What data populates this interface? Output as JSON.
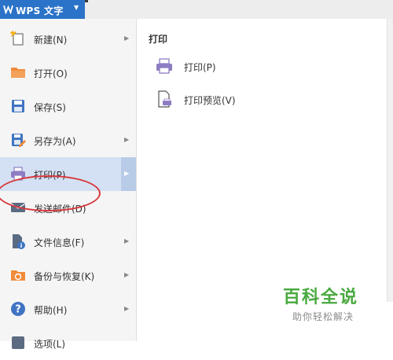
{
  "app": {
    "title": "WPS 文字",
    "logo": "W"
  },
  "menu": {
    "items": [
      {
        "label": "新建(N)",
        "icon": "new-document-icon",
        "has_submenu": true
      },
      {
        "label": "打开(O)",
        "icon": "folder-open-icon",
        "has_submenu": false
      },
      {
        "label": "保存(S)",
        "icon": "save-icon",
        "has_submenu": false
      },
      {
        "label": "另存为(A)",
        "icon": "save-as-icon",
        "has_submenu": true
      },
      {
        "label": "打印(P)",
        "icon": "printer-icon",
        "has_submenu": true,
        "active": true
      },
      {
        "label": "发送邮件(D)",
        "icon": "mail-icon",
        "has_submenu": false
      },
      {
        "label": "文件信息(F)",
        "icon": "file-info-icon",
        "has_submenu": true
      },
      {
        "label": "备份与恢复(K)",
        "icon": "backup-icon",
        "has_submenu": true
      },
      {
        "label": "帮助(H)",
        "icon": "help-icon",
        "has_submenu": true
      },
      {
        "label": "选项(L)",
        "icon": "options-icon",
        "has_submenu": false
      }
    ]
  },
  "submenu": {
    "title": "打印",
    "items": [
      {
        "label": "打印(P)",
        "icon": "printer-icon"
      },
      {
        "label": "打印预览(V)",
        "icon": "print-preview-icon"
      }
    ]
  },
  "watermark": {
    "brand": "百科全说",
    "tagline": "助你轻松解决"
  },
  "colors": {
    "title_bar": "#2b73c8",
    "active_item": "#d4e1f4",
    "annotation": "#d9373b",
    "watermark": "#48a93e",
    "printer_icon": "#8e7cc3"
  }
}
